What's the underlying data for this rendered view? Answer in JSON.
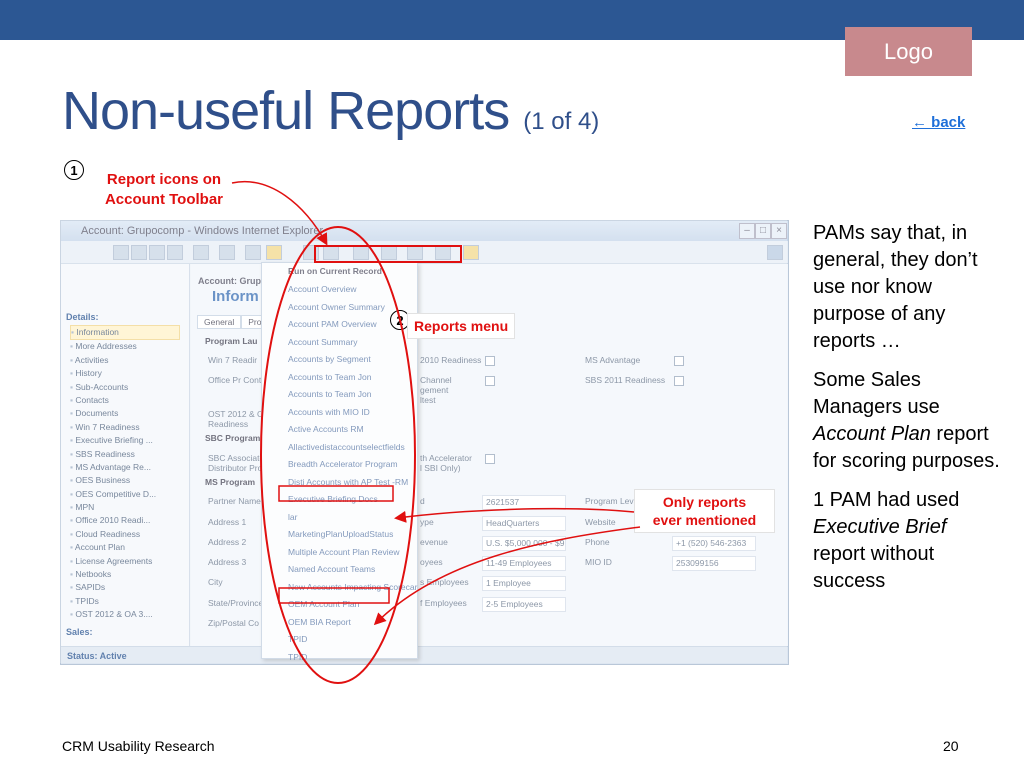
{
  "slide": {
    "logo": "Logo",
    "title_main": "Non-useful Reports",
    "title_sub": "(1 of 4)",
    "back_link": "← back",
    "footer_left": "CRM Usability Research",
    "footer_right": "20"
  },
  "callouts": {
    "one_num": "1",
    "one_text_line1": "Report icons on",
    "one_text_line2": "Account Toolbar",
    "two_num": "2",
    "two_text": "Reports menu",
    "three_line1": "Only reports",
    "three_line2": "ever mentioned"
  },
  "notes": {
    "p1": "PAMs say that, in general, they don’t use nor know purpose of any reports …",
    "p2_a": "Some Sales Managers use ",
    "p2_italic": "Account Plan",
    "p2_b": " report for scoring purposes.",
    "p3_a": "1 PAM had used ",
    "p3_italic": "Executive Brief",
    "p3_b": " report without success"
  },
  "window": {
    "title": "Account: Grupocomp - Windows Internet Explorer",
    "details_header": "Details:",
    "sales_header": "Sales:",
    "status": "Status: Active",
    "account_header": "Account: Grupoc",
    "info_title": "Inform",
    "tab_general": "General",
    "tab_pro": "Pro",
    "nav_items": [
      "Information",
      "More Addresses",
      "Activities",
      "History",
      "Sub-Accounts",
      "Contacts",
      "Documents",
      "Win 7 Readiness",
      "Executive Briefing ...",
      "SBS Readiness",
      "MS Advantage Re...",
      "OES Business",
      "OES Competitive D...",
      "MPN",
      "Office 2010 Readi...",
      "Cloud Readiness",
      "Account Plan",
      "License Agreements",
      "Netbooks",
      "SAPIDs",
      "TPIDs",
      "OST 2012 & OA 3...."
    ],
    "menu_header": "Run on Current Record",
    "menu_items": [
      "Account Overview",
      "Account Owner Summary",
      "Account PAM Overview",
      "Account Summary",
      "Accounts by Segment",
      "Accounts to Team Jon",
      "Accounts to Team Jon",
      "Accounts with MIO ID",
      "Active Accounts RM",
      "Allactivedistaccountselectfields",
      "Breadth Accelerator Program",
      "Disti Accounts with AP Test -RM",
      "Executive Briefing Docs",
      "lar",
      "MarketingPlanUploadStatus",
      "Multiple Account Plan Review",
      "Named Account Teams",
      "New Accounts Impacting Scorecard",
      "OEM Account Plan",
      "OEM BIA Report",
      "TPID",
      "TPID"
    ],
    "form": {
      "program_lbl": "Program Lau",
      "win7_lbl": "Win 7 Readir",
      "office_lbl": "Office Pr Cont",
      "ost_lbl1": "OST 2012 & Oc",
      "ost_lbl2": "Readiness",
      "sbc_sec": "SBC Program",
      "sbc_lbl1": "SBC Associate",
      "sbc_lbl2": "Distributor Proc",
      "ms_sec": "MS Program",
      "partner_lbl": "Partner Name",
      "addr1_lbl": "Address 1",
      "addr2_lbl": "Address 2",
      "addr3_lbl": "Address 3",
      "city_lbl": "City",
      "state_lbl": "State/Province",
      "zip_lbl": "Zip/Postal Co",
      "mid_2010": "2010 Readiness",
      "mid_channel1": "Channel",
      "mid_channel2": "gement",
      "mid_channel3": "ltest",
      "mid_accel1": "th Accelerator",
      "mid_accel2": "l SBI Only)",
      "mid_id": "d",
      "mid_type": "ype",
      "mid_rev": "evenue",
      "mid_emp": "oyees",
      "mid_emp2": "s Employees",
      "mid_emp3": "f Employees",
      "val_id": "2621537",
      "val_type": "HeadQuarters",
      "val_rev": "U.S. $5,000,000 - $9...",
      "val_emp": "11-49 Employees",
      "val_emp2": "1 Employee",
      "val_emp3": "2-5 Employees",
      "ms_adv": "MS Advantage",
      "sbs_2011": "SBS 2011 Readiness",
      "prog_lev": "Program Lev",
      "website": "Website",
      "phone_lbl": "Phone",
      "phone_val": "+1 (520) 546-2363",
      "mio_lbl": "MIO ID",
      "mio_val": "253099156"
    }
  },
  "colors": {
    "topbar": "#2c5793",
    "logo_bg": "#c8898d",
    "title": "#2f4f8a",
    "callout_red": "#e01010",
    "link": "#1e6fd9"
  }
}
